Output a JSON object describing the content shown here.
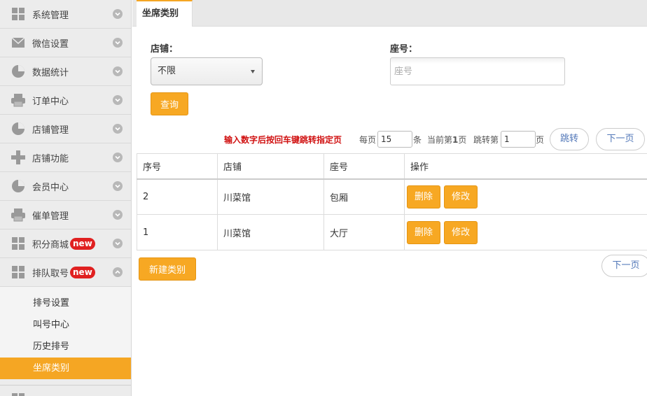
{
  "sidebar": {
    "menu": [
      {
        "label": "系统管理",
        "icon": "grid-icon"
      },
      {
        "label": "微信设置",
        "icon": "mail-icon"
      },
      {
        "label": "数据统计",
        "icon": "pie-chart-icon"
      },
      {
        "label": "订单中心",
        "icon": "printer-icon"
      },
      {
        "label": "店铺管理",
        "icon": "pie-chart-icon"
      },
      {
        "label": "店铺功能",
        "icon": "plus-icon"
      },
      {
        "label": "会员中心",
        "icon": "pie-chart-icon"
      },
      {
        "label": "催单管理",
        "icon": "printer-icon"
      },
      {
        "label": "积分商城",
        "icon": "grid-icon",
        "badge": "new"
      },
      {
        "label": "排队取号",
        "icon": "grid-icon",
        "badge": "new",
        "expanded": true
      }
    ],
    "submenu": [
      "排号设置",
      "叫号中心",
      "历史排号",
      "坐席类别"
    ],
    "active_submenu": "坐席类别",
    "accent": "#f5a623"
  },
  "tab": {
    "label": "坐席类别"
  },
  "filters": {
    "store_label": "店铺：",
    "store_value": "不限",
    "seat_label": "座号：",
    "seat_placeholder": "座号",
    "query_button": "查询"
  },
  "pager": {
    "hint": "输入数字后按回车键跳转指定页",
    "per_page_prefix": "每页",
    "per_page_value": "15",
    "per_page_suffix": "条",
    "current_prefix": "当前第",
    "current_page": "1",
    "current_suffix": "页",
    "jump_prefix": "跳转第",
    "jump_value": "1",
    "jump_suffix": "页",
    "jump_button": "跳转",
    "next_button": "下一页"
  },
  "table": {
    "headers": [
      "序号",
      "店铺",
      "座号",
      "操作"
    ],
    "rows": [
      {
        "id": "2",
        "store": "川菜馆",
        "seat": "包厢",
        "delete": "删除",
        "edit": "修改"
      },
      {
        "id": "1",
        "store": "川菜馆",
        "seat": "大厅",
        "delete": "删除",
        "edit": "修改"
      }
    ]
  },
  "footer": {
    "new_button": "新建类别",
    "next_button": "下一页"
  }
}
